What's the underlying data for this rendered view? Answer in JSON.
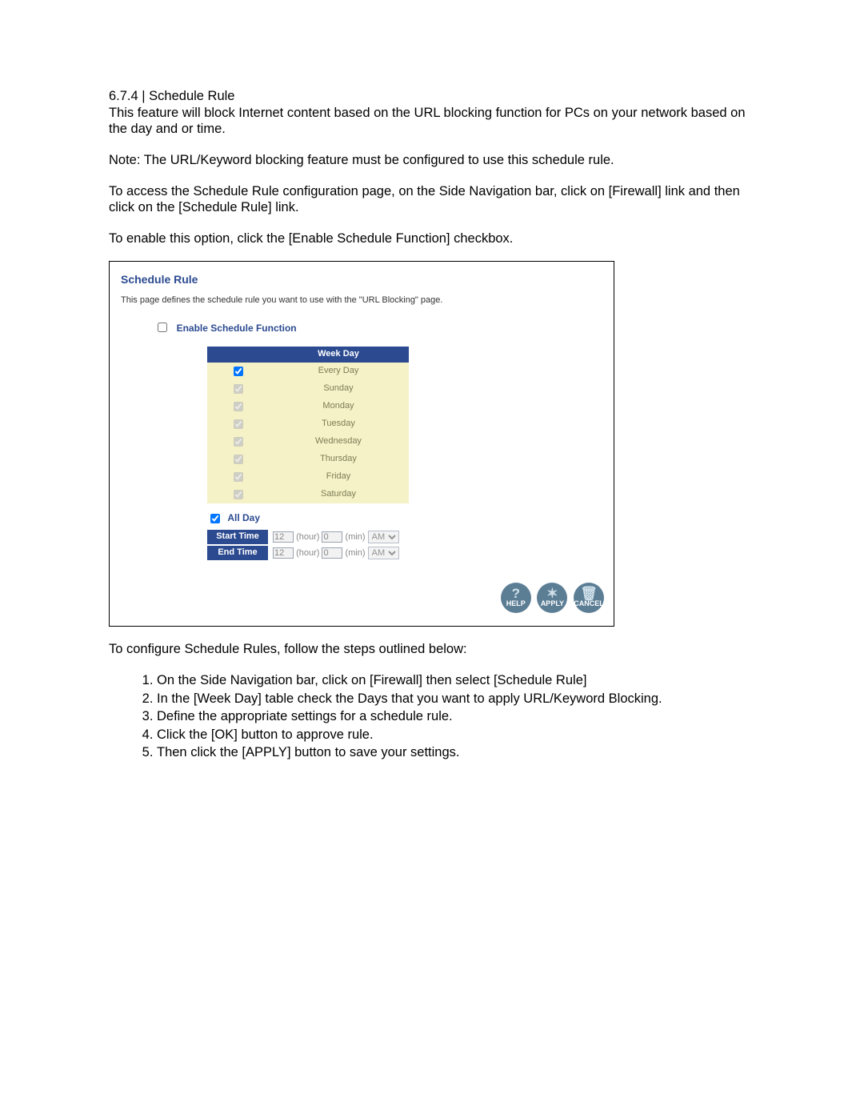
{
  "doc": {
    "section_heading": "6.7.4 | Schedule Rule",
    "intro1": "This feature will block Internet content based on the URL blocking function for PCs on your network based on the day and or time.",
    "note": "Note: The URL/Keyword blocking feature must be configured to use this schedule rule.",
    "access": "To access the Schedule Rule configuration page, on the Side Navigation bar, click on [Firewall] link and then click on the [Schedule Rule] link.",
    "enable": "To enable this option, click the [Enable Schedule Function] checkbox.",
    "config_intro": "To configure Schedule Rules, follow the steps outlined below:",
    "steps": [
      "On the Side Navigation bar, click on [Firewall] then select [Schedule Rule]",
      "In the [Week Day] table check the Days that you want to apply URL/Keyword Blocking.",
      "Define the appropriate settings for a schedule rule.",
      "Click the [OK] button to approve rule.",
      "Then click the [APPLY] button to save your settings."
    ]
  },
  "panel": {
    "title": "Schedule Rule",
    "desc": "This page defines the schedule rule you want to use with the \"URL Blocking\" page.",
    "enable_label": "Enable Schedule Function",
    "weekday_header": "Week Day",
    "days": [
      "Every Day",
      "Sunday",
      "Monday",
      "Tuesday",
      "Wednesday",
      "Thursday",
      "Friday",
      "Saturday"
    ],
    "allday_label": "All Day",
    "start_label": "Start Time",
    "end_label": "End Time",
    "hour_unit": "(hour)",
    "min_unit": "(min)",
    "start": {
      "hour": "12",
      "min": "0",
      "ampm": "AM"
    },
    "end": {
      "hour": "12",
      "min": "0",
      "ampm": "AM"
    },
    "buttons": {
      "help": "HELP",
      "apply": "APPLY",
      "cancel": "CANCEL"
    }
  }
}
